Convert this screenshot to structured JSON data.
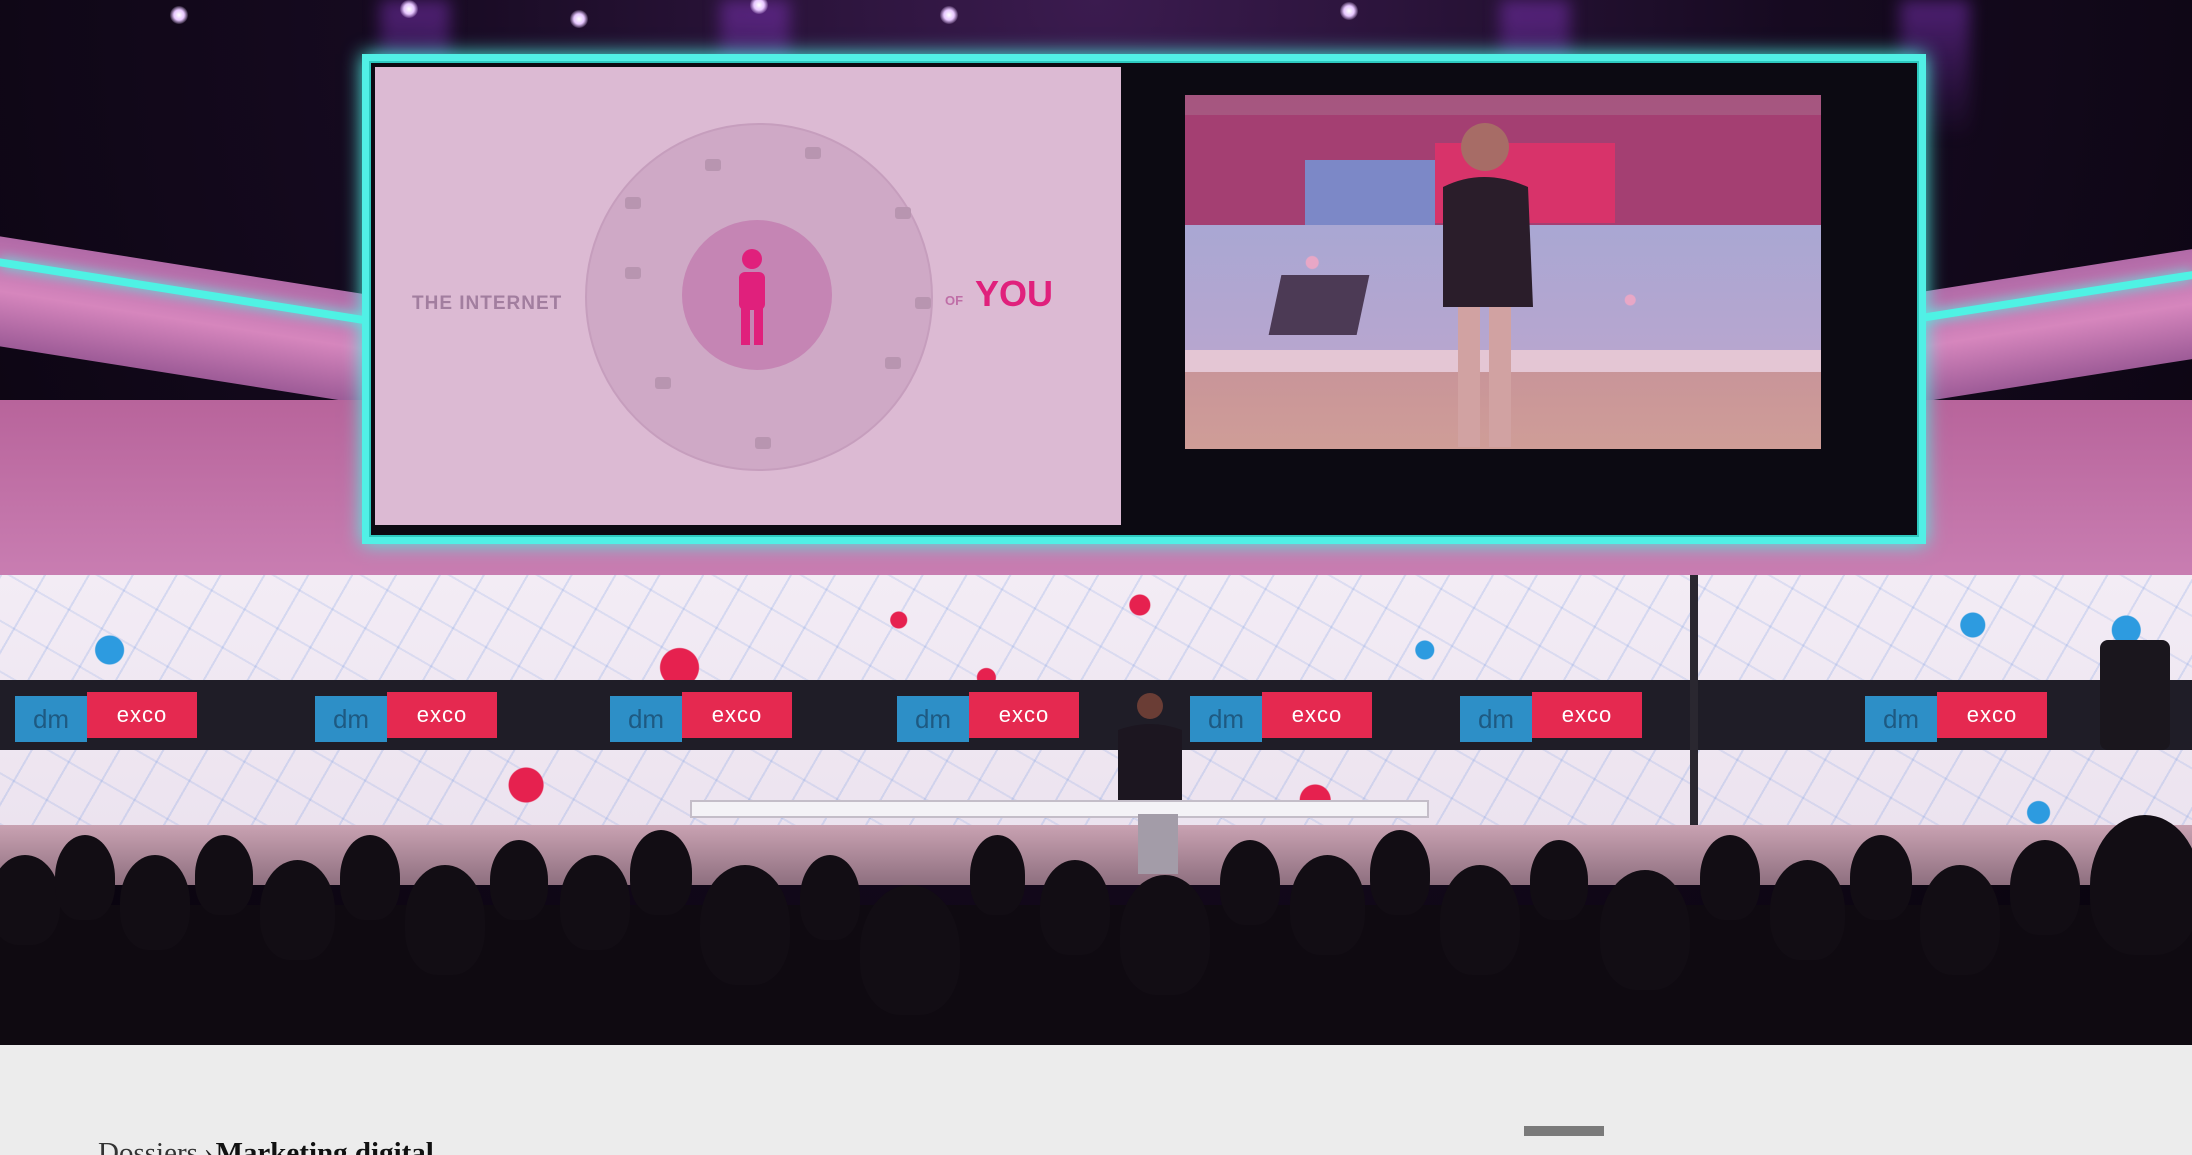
{
  "hero": {
    "slide_text_left": "THE INTERNET",
    "slide_text_of": "OF",
    "slide_text_you": "YOU",
    "brand_dm": "dm",
    "brand_exco": "exco"
  },
  "breadcrumb": {
    "parent": "Dossiers",
    "separator": "›",
    "current": "Marketing digital"
  },
  "colors": {
    "frame_accent": "#51f0e6",
    "brand_blue": "#2d8fc7",
    "brand_red": "#e52950",
    "slide_accent": "#e0207c",
    "strip_background": "#ececec"
  }
}
